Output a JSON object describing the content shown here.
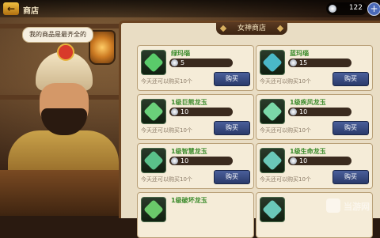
{
  "header": {
    "title": "商店",
    "currency_value": "122",
    "currency_icon": "silver-coin-icon",
    "add_icon": "plus-icon"
  },
  "merchant": {
    "speech": "我的商品是最齐全的"
  },
  "shop": {
    "title": "女神商店",
    "items": [
      {
        "name": "绿玛瑙",
        "price": "5",
        "limit": "今天还可以购买10个",
        "buy_label": "购买",
        "icon": "green-agate-icon",
        "color": "#5acb6a"
      },
      {
        "name": "蓝玛瑙",
        "price": "15",
        "limit": "今天还可以购买10个",
        "buy_label": "购买",
        "icon": "blue-agate-icon",
        "color": "#4ab8c8"
      },
      {
        "name": "1级巨熊龙玉",
        "price": "10",
        "limit": "今天还可以购买10个",
        "buy_label": "购买",
        "icon": "bear-dragon-jade-icon",
        "color": "#6ad07a"
      },
      {
        "name": "1级疾风龙玉",
        "price": "10",
        "limit": "今天还可以购买10个",
        "buy_label": "购买",
        "icon": "wind-dragon-jade-icon",
        "color": "#7ad8a8"
      },
      {
        "name": "1级智慧龙玉",
        "price": "10",
        "limit": "今天还可以购买10个",
        "buy_label": "购买",
        "icon": "wisdom-dragon-jade-icon",
        "color": "#5ac08a"
      },
      {
        "name": "1级生命龙玉",
        "price": "10",
        "limit": "今天还可以购买10个",
        "buy_label": "购买",
        "icon": "life-dragon-jade-icon",
        "color": "#6ac8b8"
      },
      {
        "name": "1级破坏龙玉",
        "price": "",
        "limit": "",
        "buy_label": "",
        "icon": "destroy-dragon-jade-icon",
        "color": "#6ac86a"
      },
      {
        "name": "",
        "price": "",
        "limit": "",
        "buy_label": "",
        "icon": "dragon-jade-icon",
        "color": "#6ac8b8"
      }
    ]
  },
  "watermark": {
    "text": "当游网"
  }
}
